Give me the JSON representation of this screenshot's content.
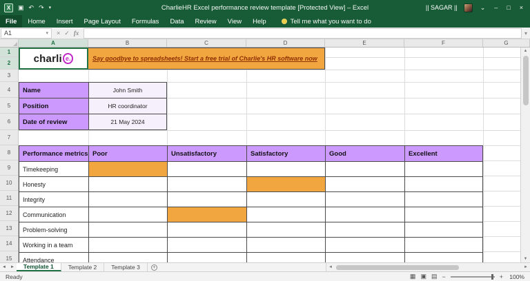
{
  "colors": {
    "excel_green": "#185C37",
    "accent_green": "#217346",
    "orange": "#F2A640",
    "purple": "#CC99FF"
  },
  "title_bar": {
    "app_icon": "X",
    "quick_access": {
      "save": "▣",
      "undo": "↶",
      "redo": "↷",
      "more": "▾"
    },
    "title": "CharlieHR Excel performance review template  [Protected View] – Excel",
    "user": "|| SAGAR ||",
    "window": {
      "options": "⌄",
      "minimize": "–",
      "maximize": "□",
      "close": "×"
    }
  },
  "ribbon": {
    "tabs": [
      {
        "label": "File"
      },
      {
        "label": "Home"
      },
      {
        "label": "Insert"
      },
      {
        "label": "Page Layout"
      },
      {
        "label": "Formulas"
      },
      {
        "label": "Data"
      },
      {
        "label": "Review"
      },
      {
        "label": "View"
      },
      {
        "label": "Help"
      }
    ],
    "tell_me": "Tell me what you want to do"
  },
  "formula_bar": {
    "name_box": "A1",
    "name_chevron": "▾",
    "cancel": "×",
    "enter": "✓",
    "fx": "fx",
    "value": "",
    "end_chevron": "▾"
  },
  "grid": {
    "columns": [
      "A",
      "B",
      "C",
      "D",
      "E",
      "F",
      "G"
    ],
    "rows": [
      "1",
      "2",
      "3",
      "4",
      "5",
      "6",
      "7",
      "8",
      "9",
      "10",
      "11",
      "12",
      "13",
      "14",
      "15"
    ]
  },
  "sheet": {
    "logo": {
      "text": "charli",
      "e": "e."
    },
    "banner": "Say goodbye to spreadsheets! Start a free trial of Charlie's HR software now",
    "info": [
      {
        "label": "Name",
        "value": "John Smith"
      },
      {
        "label": "Position",
        "value": "HR coordinator"
      },
      {
        "label": "Date of review",
        "value": "21 May 2024"
      }
    ],
    "table": {
      "headers": [
        "Performance metrics",
        "Poor",
        "Unsatisfactory",
        "Satisfactory",
        "Good",
        "Excellent"
      ],
      "rows": [
        {
          "label": "Timekeeping",
          "highlight": "Poor"
        },
        {
          "label": "Honesty",
          "highlight": "Satisfactory"
        },
        {
          "label": "Integrity",
          "highlight": null
        },
        {
          "label": "Communication",
          "highlight": "Unsatisfactory"
        },
        {
          "label": "Problem-solving",
          "highlight": null
        },
        {
          "label": "Working in a team",
          "highlight": null
        },
        {
          "label": "Attendance",
          "highlight": null
        }
      ]
    }
  },
  "sheet_tabs": {
    "nav_left": "◄",
    "nav_right": "►",
    "tabs": [
      {
        "label": "Template 1",
        "active": true
      },
      {
        "label": "Template 2",
        "active": false
      },
      {
        "label": "Template 3",
        "active": false
      }
    ],
    "add": "+"
  },
  "scrollbars": {
    "up": "▲",
    "down": "▼",
    "left": "◄",
    "right": "►"
  },
  "status_bar": {
    "ready": "Ready",
    "views": [
      "▦",
      "▣",
      "▤"
    ],
    "zoom_out": "−",
    "zoom_in": "+",
    "zoom": "100%"
  }
}
